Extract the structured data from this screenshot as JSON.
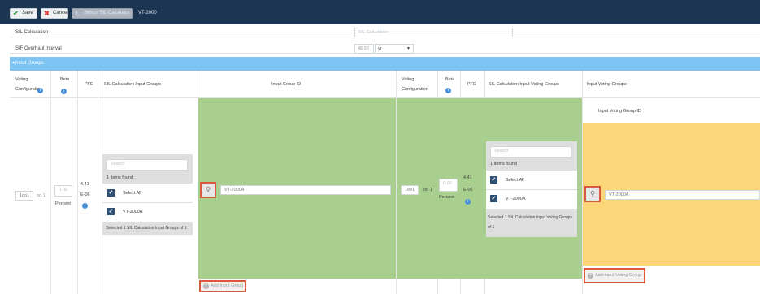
{
  "toolbar": {
    "save_label": "Save",
    "cancel_label": "Cancel",
    "sum_label": "Switch SIL Calculator",
    "title": "VT-2000"
  },
  "form": {
    "sil_label": "SIL Calculation",
    "sil_placeholder": "SIL Calculation",
    "interval_label": "SIF Overhaul Interval",
    "interval_value": "48.00",
    "interval_unit": "yr"
  },
  "section": {
    "title": "Input Groups"
  },
  "table": {
    "headers": {
      "voting_config_1": "Voting",
      "voting_config_2": "Configuration",
      "beta": "Beta",
      "pfd": "PFD",
      "sil_input_groups": "SIL Calculation Input Groups",
      "input_group_id": "Input Group ID",
      "voting_config_b1": "Voting",
      "voting_config_b2": "Configuration",
      "beta_b": "Beta",
      "pfd_b": "PFD",
      "sil_input_voting_groups": "SIL Calculation Input Voting Groups",
      "input_voting_groups": "Input Voting Groups",
      "input_voting_group_id": "Input Voting Group ID"
    },
    "left": {
      "vote_a": "1oo1",
      "vote_of": "oo 1",
      "beta_value": "0.00",
      "beta_unit": "Percent",
      "pfd_value_1": "4.41",
      "pfd_value_2": "E-06",
      "search_placeholder": "Search",
      "found": "1 items found",
      "select_all": "Select All",
      "item": "VT-2000A",
      "selected": "Selected 1 SIL Calculation Input Groups of 1",
      "input_group_value": "VT-2000A",
      "add_label": "Add Input Group"
    },
    "right": {
      "vote_a": "1oo1",
      "vote_of": "oo 1",
      "beta_value": "0.00",
      "beta_unit": "Percent",
      "pfd_value_1": "4.41",
      "pfd_value_2": "E-06",
      "search_placeholder": "Search",
      "found": "1 items found",
      "select_all": "Select All",
      "item": "VT-2000A",
      "selected": "Selected 1 SIL Calculation Input Voting Groups of 1",
      "voting_group_value": "VT-2000A",
      "add_label": "Add Input Voting Group"
    }
  },
  "colors": {
    "toolbar": "#1c3553",
    "section": "#7dc4f2",
    "green": "#a8cf8e",
    "yellow": "#fdd67a",
    "highlight": "#d9583e"
  },
  "icons": [
    "check-icon",
    "x-icon",
    "sigma-icon",
    "info-icon",
    "link-icon",
    "plus-icon",
    "caret-icon"
  ]
}
